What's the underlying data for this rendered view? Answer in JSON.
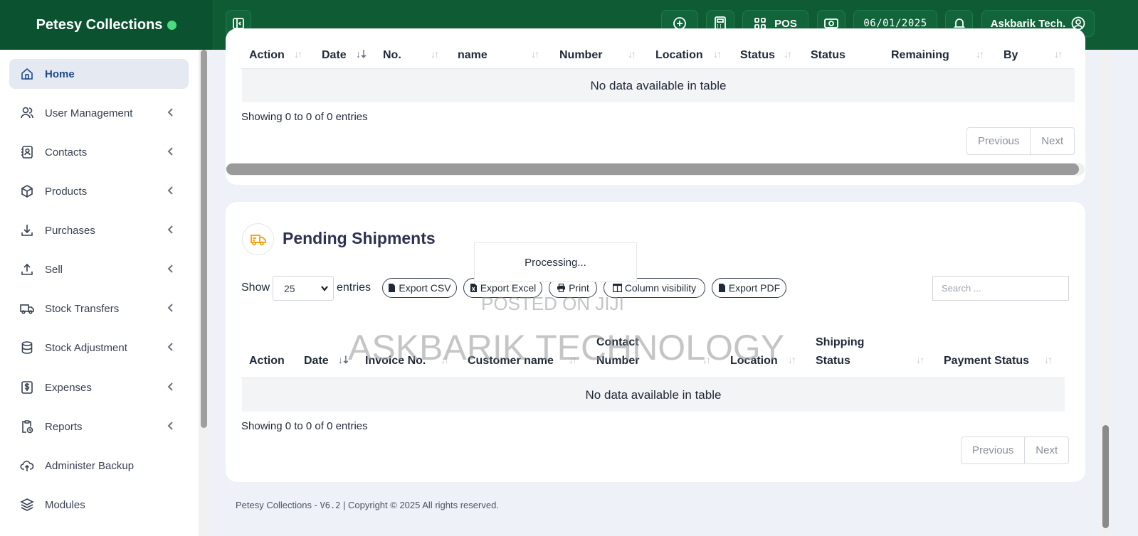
{
  "header": {
    "brand": "Petesy Collections",
    "pos_label": "POS",
    "date": "06/01/2025",
    "user": "Askbarik Tech."
  },
  "sidebar": {
    "items": [
      {
        "label": "Home",
        "icon": "home-icon",
        "active": true
      },
      {
        "label": "User Management",
        "icon": "users-icon"
      },
      {
        "label": "Contacts",
        "icon": "contacts-icon"
      },
      {
        "label": "Products",
        "icon": "box-icon"
      },
      {
        "label": "Purchases",
        "icon": "download-icon"
      },
      {
        "label": "Sell",
        "icon": "upload-icon"
      },
      {
        "label": "Stock Transfers",
        "icon": "truck-icon"
      },
      {
        "label": "Stock Adjustment",
        "icon": "database-icon"
      },
      {
        "label": "Expenses",
        "icon": "dollar-icon"
      },
      {
        "label": "Reports",
        "icon": "clipboard-icon"
      },
      {
        "label": "Administer Backup",
        "icon": "cloud-upload-icon"
      },
      {
        "label": "Modules",
        "icon": "layers-icon"
      }
    ]
  },
  "top_table": {
    "columns": [
      "Action",
      "Date",
      "No.",
      "name",
      "Number",
      "Location",
      "Status",
      "Status",
      "Remaining",
      "By"
    ],
    "empty": "No data available in table",
    "info": "Showing 0 to 0 of 0 entries",
    "prev": "Previous",
    "next": "Next"
  },
  "shipments": {
    "title": "Pending Shipments",
    "processing": "Processing...",
    "show": "Show",
    "page_size": "25",
    "entries": "entries",
    "buttons": {
      "csv": "Export CSV",
      "excel": "Export Excel",
      "print": "Print",
      "colvis": "Column visibility",
      "pdf": "Export PDF"
    },
    "search_placeholder": "Search ...",
    "columns": {
      "action": "Action",
      "date": "Date",
      "invoice": "Invoice No.",
      "customer": "Customer name",
      "contact_1": "Contact",
      "contact_2": "Number",
      "location": "Location",
      "shipping_1": "Shipping",
      "shipping_2": "Status",
      "payment": "Payment Status"
    },
    "empty": "No data available in table",
    "info": "Showing 0 to 0 of 0 entries",
    "prev": "Previous",
    "next": "Next"
  },
  "watermarks": {
    "posted": "POSTED ON JIJI",
    "company": "ASKBARIK TECHNOLOGY"
  },
  "footer": {
    "name": "Petesy Collections - ",
    "version": "V6.2",
    "rest": " | Copyright © 2025 All rights reserved."
  }
}
